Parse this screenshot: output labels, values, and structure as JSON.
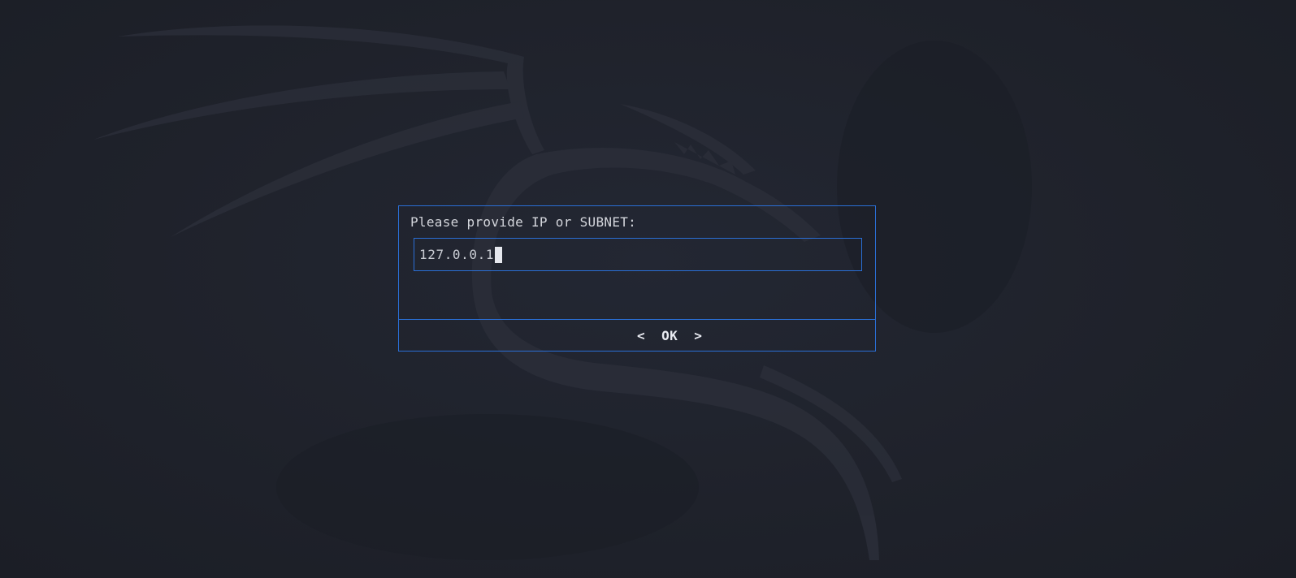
{
  "dialog": {
    "prompt": "Please provide IP or SUBNET:",
    "input_value": "127.0.0.1",
    "ok_button": {
      "left_bracket": "<",
      "label": "OK",
      "right_bracket": ">"
    }
  },
  "colors": {
    "background": "#1e212a",
    "border": "#2a6fd6",
    "text": "#d4d6dc",
    "wallpaper_dragon": "#2a2d38"
  },
  "wallpaper": {
    "icon": "kali-dragon-icon"
  }
}
